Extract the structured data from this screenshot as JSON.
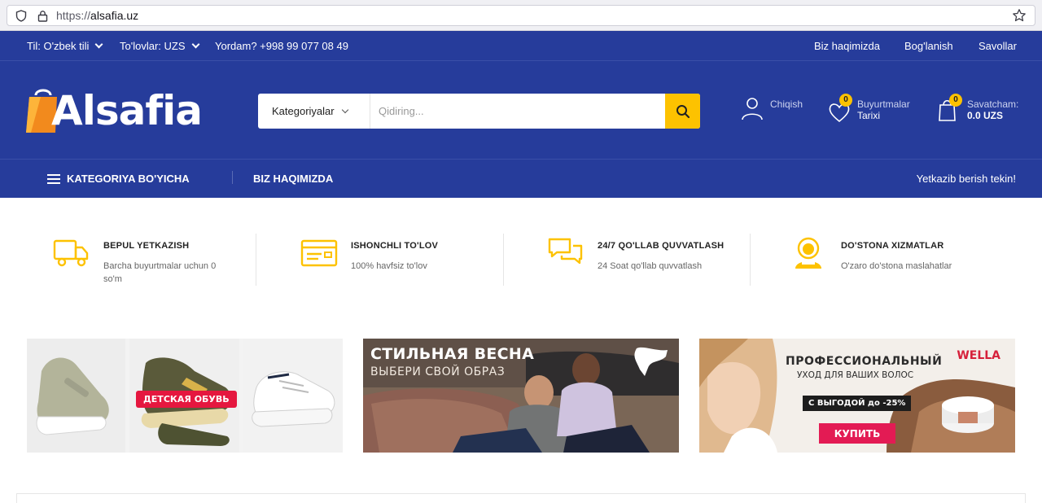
{
  "browser": {
    "url_prefix": "https://",
    "url_domain": "alsafia.uz"
  },
  "topbar": {
    "language": "Til: O'zbek tili",
    "payment": "To'lovlar: UZS",
    "help": "Yordam? +998 99 077 08 49",
    "links": [
      "Biz haqimizda",
      "Bog'lanish",
      "Savollar"
    ]
  },
  "header": {
    "logo_text": "Alsafia",
    "search": {
      "category_label": "Kategoriyalar",
      "placeholder": "Qidiring..."
    },
    "account": {
      "label": "Chiqish"
    },
    "orders": {
      "badge": "0",
      "line1": "Buyurtmalar",
      "line2": "Tarixi"
    },
    "cart": {
      "badge": "0",
      "line1": "Savatcham:",
      "line2": "0.0 UZS"
    }
  },
  "nav": {
    "categories": "KATEGORIYA BO'YICHA",
    "about": "BIZ HAQIMIZDA",
    "free_delivery": "Yetkazib berish tekin!"
  },
  "features": [
    {
      "icon": "truck-icon",
      "title": "BEPUL YETKAZISH",
      "desc": "Barcha buyurtmalar uchun 0 so'm"
    },
    {
      "icon": "credit-card-icon",
      "title": "ISHONCHLI TO'LOV",
      "desc": "100% havfsiz to'lov"
    },
    {
      "icon": "chat-icon",
      "title": "24/7 QO'LLAB QUVVATLASH",
      "desc": "24 Soat qo'llab quvvatlash"
    },
    {
      "icon": "support-agent-icon",
      "title": "DO'STONA XIZMATLAR",
      "desc": "O'zaro do'stona maslahatlar"
    }
  ],
  "banners": {
    "kids": {
      "tag": "ДЕТСКАЯ ОБУВЬ"
    },
    "puma": {
      "title": "СТИЛЬНАЯ ВЕСНА",
      "subtitle": "ВЫБЕРИ СВОЙ ОБРАЗ"
    },
    "wella": {
      "title": "ПРОФЕССИОНАЛЬНЫЙ",
      "subtitle": "УХОД ДЛЯ ВАШИХ ВОЛОС",
      "promo": "С ВЫГОДОЙ до -25%",
      "button": "КУПИТЬ",
      "brand": "WELLA"
    }
  },
  "colors": {
    "primary": "#263c9b",
    "accent": "#fdc200",
    "sale_red": "#e31b54"
  }
}
